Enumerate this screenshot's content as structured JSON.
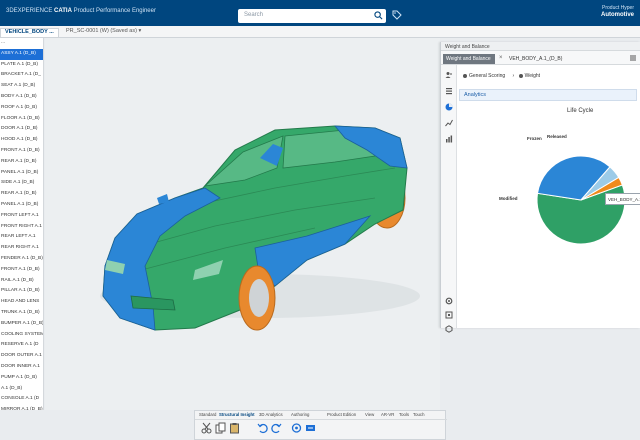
{
  "app": {
    "brand_prefix": "3DEXPERIENCE",
    "brand_app": "CATIA",
    "brand_role": "Product Performance Engineer",
    "user_line1": "Product Hyper",
    "user_line2": "Automotive",
    "search_placeholder": "Search"
  },
  "tabs": {
    "active": "VEHICLE_BODY ...",
    "second": "PR_SC-0001 (W) (Saved as) ▾"
  },
  "tree": {
    "rows": [
      "...",
      "ASSY A.1 (D_B)",
      "PLATE A.1 (D_B)",
      "BRACKET A.1 (D_",
      "SEAT A.1 (D_B)",
      "BODY A.1 (D_B)",
      "ROOF A.1 (D_B)",
      "FLOOR A.1 (D_B)",
      "DOOR A.1 (D_B)",
      "HOOD A.1 (D_B)",
      "FRONT A.1 (D_B)",
      "REAR A.1 (D_B)",
      "PANEL A.1 (D_B)",
      "SIDE A.1 (D_B)",
      "REAR A.1 (D_B)",
      "PANEL A.1 (D_B)",
      "FRONT LEFT A.1",
      "FRONT RIGHT A.1",
      "REAR LEFT A.1",
      "REAR RIGHT A.1",
      "FENDER A.1 (D_B)",
      "FRONT A.1 (D_B)",
      "RAIL A.1 (D_B)",
      "PILLAR A.1 (D_B)",
      "HEAD AND LENS",
      "TRUNK A.1 (D_B)",
      "BUMPER A.1 (D_B)",
      "COOLING SYSTEM",
      "RESERVE A.1 (D",
      "DOOR OUTER A.1",
      "DOOR INNER A.1",
      "PUMP A.1 (D_B)",
      "A.1 (D_B)",
      "CONSOLE A.1 (D",
      "MIRROR A.1 (D_B)",
      "GLASS A.1 (D_B)"
    ]
  },
  "panel": {
    "title": "Weight and Balance",
    "tab_active": "Weight and Balance",
    "tab_second": "VEH_BODY_A.1_(D_B)",
    "filter1": "General Scoring",
    "filter2": "Weight",
    "analytics_label": "Analytics",
    "chart_title": "Life Cycle",
    "tooltip": "VEH_BODY_A.1_..."
  },
  "chart_data": {
    "type": "pie",
    "title": "Life Cycle",
    "slices": [
      {
        "label": "",
        "value": 58,
        "color": "#2fa066"
      },
      {
        "label": "Modified",
        "value": 34,
        "color": "#2b86d6"
      },
      {
        "label": "Released",
        "value": 5,
        "color": "#9ccbe8"
      },
      {
        "label": "Frozen",
        "value": 3,
        "color": "#f08a1c"
      }
    ]
  },
  "bottom_toolbar": {
    "tabs": [
      "Standard",
      "Structural Insight",
      "3D Analytics",
      "Authoring",
      "Product Edition",
      "View",
      "AR-VR",
      "Tools",
      "Touch"
    ],
    "tools": [
      "cut-icon",
      "copy-icon",
      "paste-icon",
      "undo-icon",
      "redo-icon",
      "update-icon",
      "share-icon"
    ]
  },
  "colors": {
    "topbar": "#00467f",
    "accent": "#1d6fd6",
    "body_green": "#2fa066",
    "body_blue": "#2b86d6",
    "wheel_orange": "#e8892e"
  }
}
